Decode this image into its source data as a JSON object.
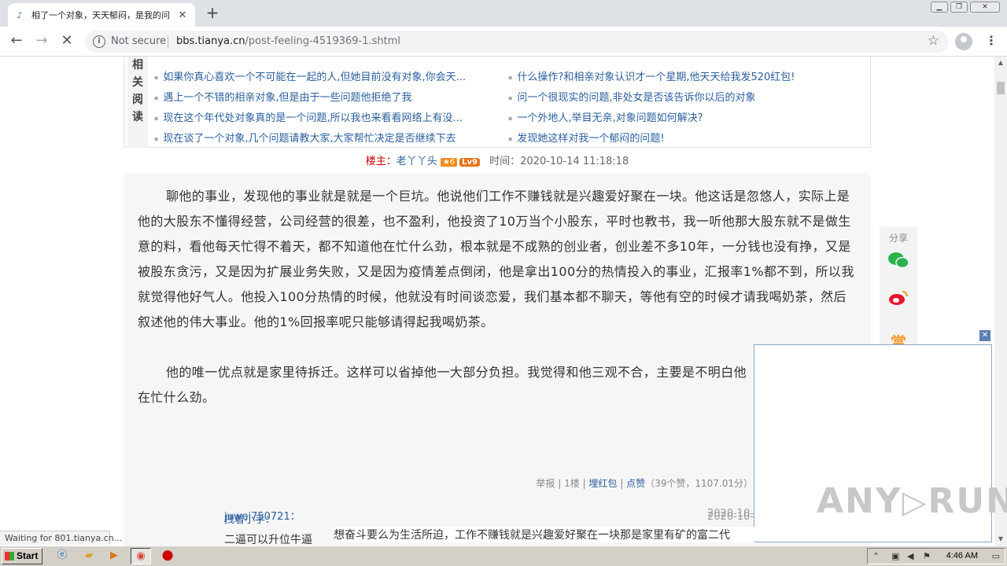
{
  "browser": {
    "tab_title": "相了一个对象，天天郁闷，是我的问题",
    "favicon": "♪",
    "new_tab": "+",
    "security_label": "Not secure",
    "url_host": "bbs.tianya.cn",
    "url_path": "/post-feeling-4519369-1.shtml",
    "status_text": "Waiting for 801.tianya.cn..."
  },
  "related": {
    "label_chars": [
      "相",
      "关",
      "阅",
      "读"
    ],
    "left_links": [
      "如果你真心喜欢一个不可能在一起的人,但她目前没有对象,你会天...",
      "遇上一个不错的相亲对象,但是由于一些问题他拒绝了我",
      "现在这个年代处对象真的是一个问题,所以我也来看看网络上有没...",
      "现在谈了一个对象,几个问题请教大家,大家帮忙决定是否继续下去"
    ],
    "right_links": [
      "什么操作?和相亲对象认识才一个星期,他天天给我发520红包!",
      "问一个很现实的问题,非处女是否该告诉你以后的对象",
      "一个外地人,举目无亲,对象问题如何解决?",
      "发现她这样对我一个郁闷的问题!"
    ]
  },
  "author": {
    "louzhu_label": "楼主：",
    "name": "老丫丫头",
    "star_badge": "★6",
    "level_badge": "Lv9",
    "time": "时间：2020-10-14 11:18:18"
  },
  "post": {
    "para1": "聊他的事业，发现他的事业就是就是一个巨坑。他说他们工作不赚钱就是兴趣爱好聚在一块。他这话是忽悠人，实际上是他的大股东不懂得经营，公司经营的很差，也不盈利，他投资了10万当个小股东，平时也教书，我一听他那大股东就不是做生意的料，看他每天忙得不着天，都不知道他在忙什么劲，根本就是不成熟的创业者，创业差不多10年，一分钱也没有挣，又是被股东贪污，又是因为扩展业务失败，又是因为疫情差点倒闭，他是拿出100分的热情投入的事业，汇报率1%都不到，所以我就觉得他好气人。他投入100分热情的时候，他就没有时间谈恋爱，我们基本都不聊天，等他有空的时候才请我喝奶茶，然后叙述他的伟大事业。他的1%回报率呢只能够请得起我喝奶茶。",
    "para2": "他的唯一优点就是家里待拆迁。这样可以省掉他一大部分负担。我觉得和他三观不合，主要是不明白他在忙什么劲。",
    "actions": {
      "report": "举报",
      "floor": "1楼",
      "red_packet": "埋红包",
      "like": "点赞",
      "stats": "（39个赞，1107.01分）"
    }
  },
  "comments": [
    {
      "user": "拽着小手：",
      "time": "2020-10-",
      "text": "二逼可以升位牛逼"
    },
    {
      "user": "juwei750721：",
      "time": "2020-10-",
      "text": "想奋斗要么为生活所迫，工作不赚钱就是兴趣爱好聚在一块那是家里有矿的富二代"
    }
  ],
  "share": {
    "label": "分享",
    "wechat_icon": "wechat-icon",
    "weibo_icon": "weibo-icon",
    "reward": "赏"
  },
  "watermark": {
    "text_left": "ANY",
    "text_right": "RUN"
  },
  "taskbar": {
    "start_label": "Start",
    "clock": "4:46 AM"
  },
  "colors": {
    "link": "#2b5f9e",
    "louzhu": "#cc0000",
    "badge": "#e8751a"
  }
}
